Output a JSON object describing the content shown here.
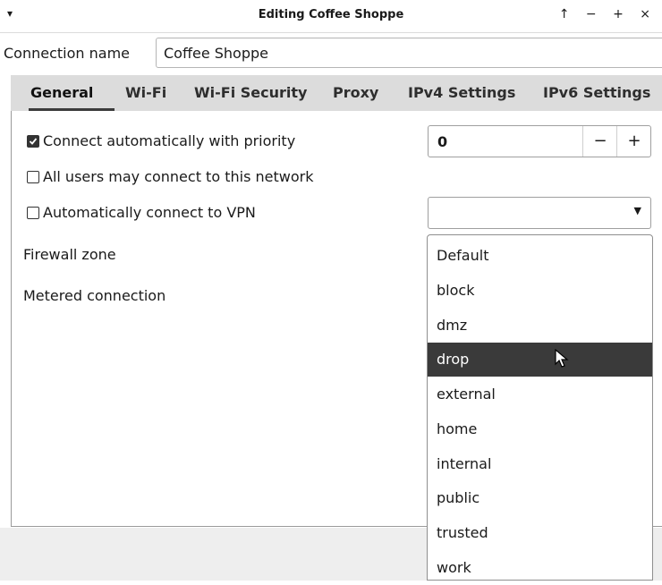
{
  "window": {
    "menu_glyph": "▾",
    "title": "Editing Coffee Shoppe",
    "buttons": "↑ − + ×"
  },
  "connection": {
    "label": "Connection name",
    "value": "Coffee Shoppe"
  },
  "tabs": [
    {
      "label": "General",
      "active": true
    },
    {
      "label": "Wi-Fi"
    },
    {
      "label": "Wi-Fi Security"
    },
    {
      "label": "Proxy"
    },
    {
      "label": "IPv4 Settings"
    },
    {
      "label": "IPv6 Settings"
    }
  ],
  "general": {
    "auto_connect": {
      "label": "Connect automatically with priority",
      "checked": true
    },
    "priority_value": "0",
    "all_users": {
      "label": "All users may connect to this network",
      "checked": false
    },
    "auto_vpn": {
      "label": "Automatically connect to VPN",
      "checked": false
    },
    "vpn_value": "",
    "firewall_zone_label": "Firewall zone",
    "metered_label": "Metered connection",
    "spin_minus": "−",
    "spin_plus": "+"
  },
  "firewall_dropdown": {
    "options": [
      "Default",
      "block",
      "dmz",
      "drop",
      "external",
      "home",
      "internal",
      "public",
      "trusted",
      "work"
    ],
    "highlighted": "drop"
  },
  "icons": {
    "dropdown_arrow": "chevron-down-icon",
    "cursor": "mouse-pointer-icon"
  }
}
